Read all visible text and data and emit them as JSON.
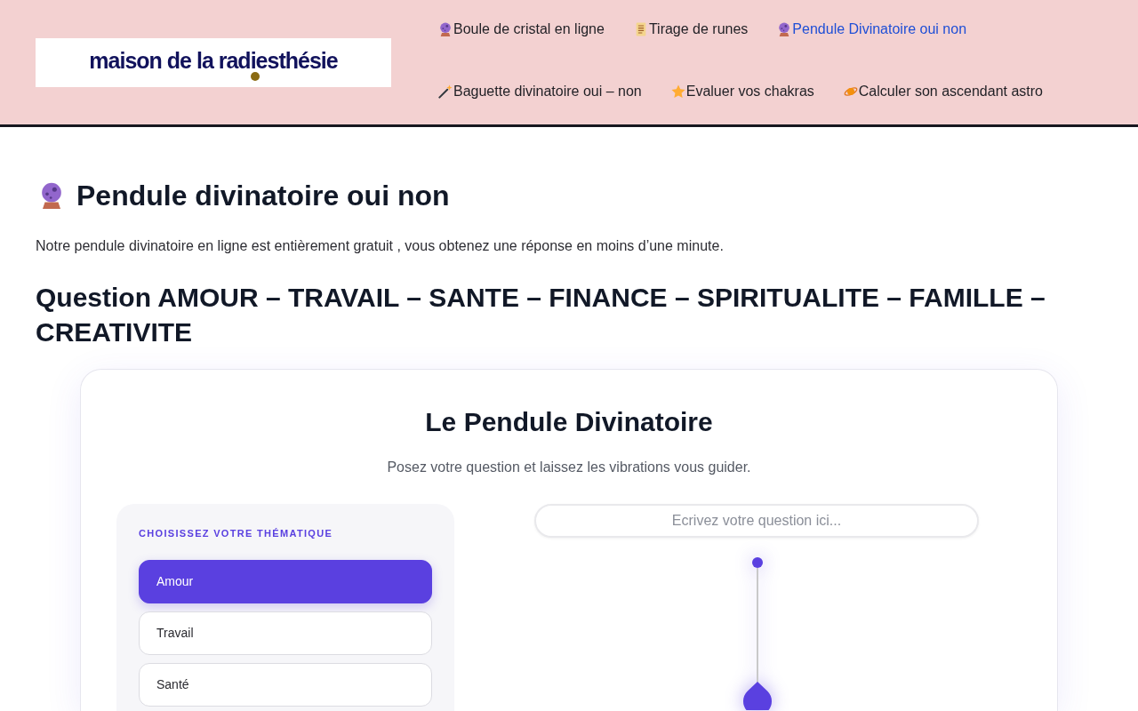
{
  "header": {
    "logo": {
      "text": "maison de la radiesthésie"
    },
    "nav": [
      {
        "label": "Boule de cristal en ligne",
        "kind": "crystal",
        "selected": false
      },
      {
        "label": "Tirage de runes",
        "kind": "scroll",
        "selected": false
      },
      {
        "label": "Pendule Divinatoire oui non",
        "kind": "crystal",
        "selected": true
      },
      {
        "label": "Baguette divinatoire oui – non",
        "kind": "wand",
        "selected": false
      },
      {
        "label": "Evaluer vos chakras",
        "kind": "star",
        "selected": false
      },
      {
        "label": "Calculer son ascendant astro",
        "kind": "planet",
        "selected": false
      }
    ]
  },
  "page": {
    "title": "Pendule divinatoire oui non",
    "intro": "Notre pendule divinatoire en ligne est entièrement gratuit , vous obtenez une réponse en moins d’une minute.",
    "heading": "Question AMOUR – TRAVAIL – SANTE – FINANCE – SPIRITUALITE – FAMILLE – CREATIVITE"
  },
  "widget": {
    "title": "Le Pendule Divinatoire",
    "subtitle": "Posez votre question et laissez les vibrations vous guider.",
    "theme_label": "CHOISISSEZ VOTRE THÉMATIQUE",
    "themes": [
      {
        "label": "Amour",
        "selected": true
      },
      {
        "label": "Travail",
        "selected": false
      },
      {
        "label": "Santé",
        "selected": false
      }
    ],
    "question": {
      "placeholder": "Ecrivez votre question ici..."
    }
  }
}
